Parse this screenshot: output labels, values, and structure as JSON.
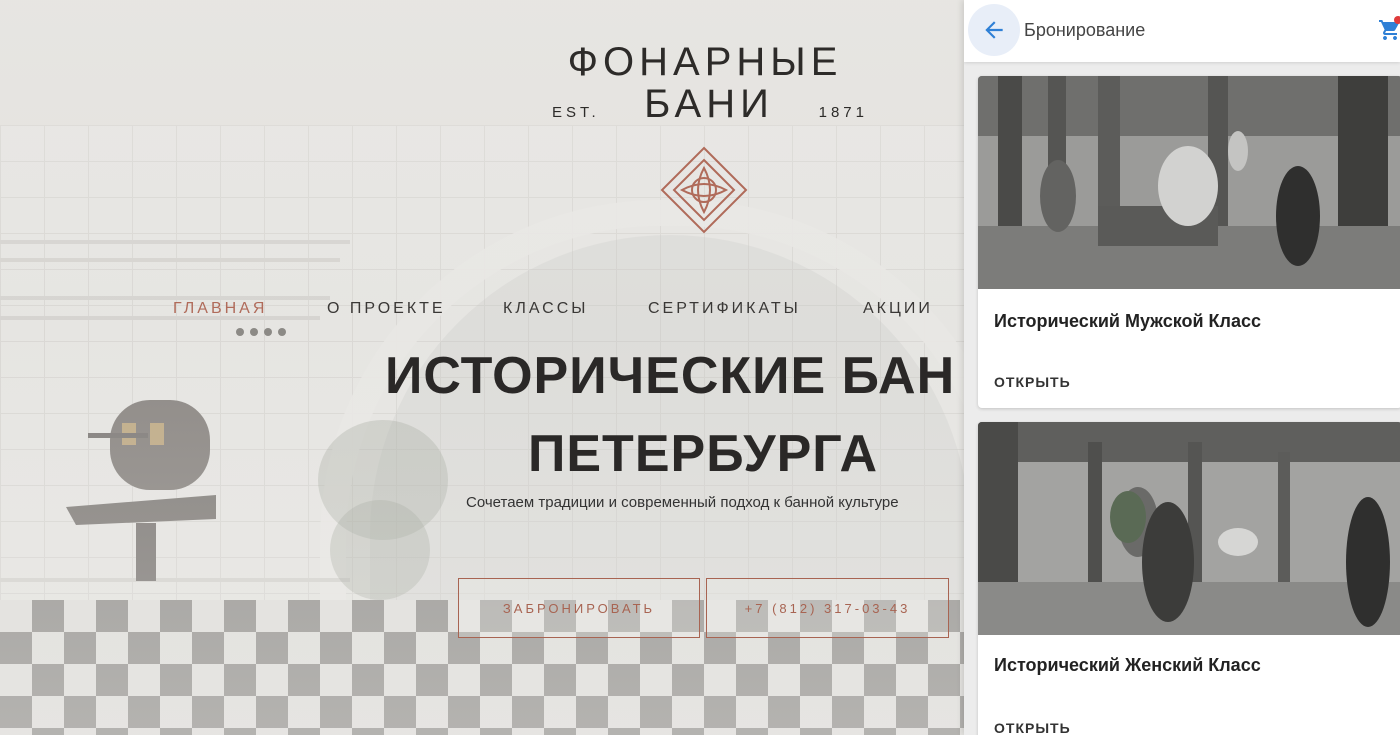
{
  "site": {
    "logo": {
      "title": "ФОНАРНЫЕ",
      "est": "EST.",
      "bani": "БАНИ",
      "year": "1871"
    },
    "nav": [
      {
        "label": "ГЛАВНАЯ",
        "active": true
      },
      {
        "label": "О ПРОЕКТЕ",
        "active": false
      },
      {
        "label": "КЛАССЫ",
        "active": false
      },
      {
        "label": "СЕРТИФИКАТЫ",
        "active": false
      },
      {
        "label": "АКЦИИ",
        "active": false
      }
    ],
    "headline": {
      "line1": "ИСТОРИЧЕСКИЕ БАН",
      "line2": "ПЕТЕРБУРГА"
    },
    "tagline": "Сочетаем традиции и современный подход к банной культуре",
    "buttons": {
      "book": "ЗАБРОНИРОВАТЬ",
      "phone": "+7 (812) 317-03-43"
    },
    "colors": {
      "accent": "#a86452",
      "text": "#2d2b29"
    }
  },
  "booking_panel": {
    "title": "Бронирование",
    "icons": {
      "back": "arrow-left-icon",
      "cart": "cart-icon"
    },
    "colors": {
      "back_arrow": "#2f80d6",
      "cart": "#2f80d6"
    },
    "cards": [
      {
        "title": "Исторический Мужской Класс",
        "action": "ОТКРЫТЬ"
      },
      {
        "title": "Исторический Женский Класс",
        "action": "ОТКРЫТЬ"
      }
    ]
  }
}
